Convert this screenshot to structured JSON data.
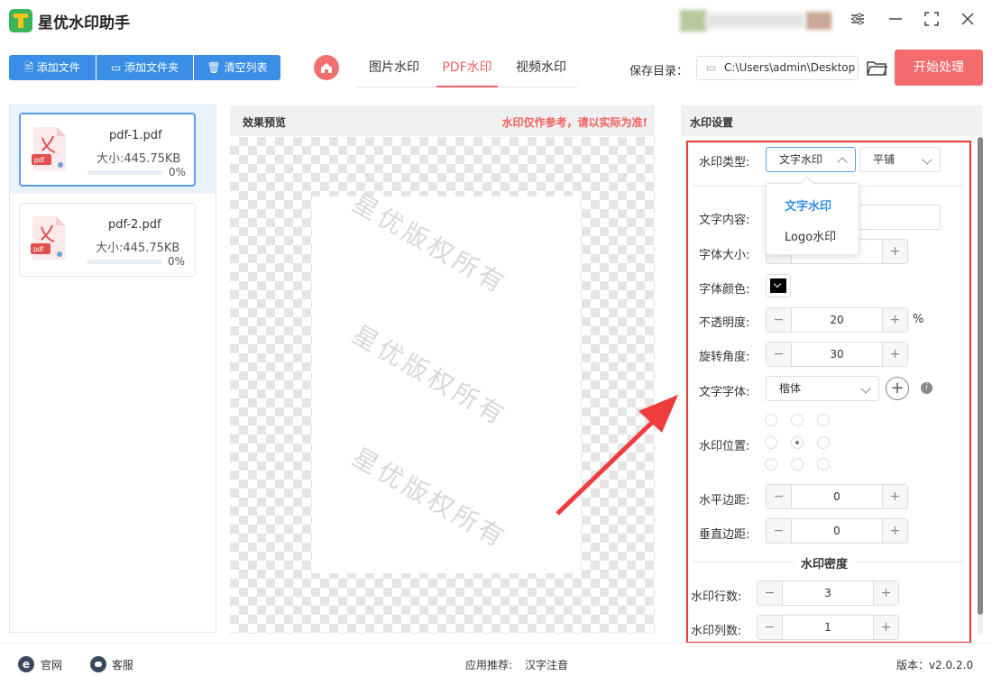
{
  "app": {
    "title": "星优水印助手"
  },
  "window_controls": [
    "settings-sliders",
    "minimize",
    "maximize",
    "close"
  ],
  "toolbar": {
    "add_file": "添加文件",
    "add_folder": "添加文件夹",
    "clear_list": "清空列表",
    "tabs": [
      "图片水印",
      "PDF水印",
      "视频水印"
    ],
    "active_tab": "PDF水印",
    "save_label": "保存目录：",
    "save_path": "C:\\Users\\admin\\Desktop",
    "start": "开始处理",
    "accent": "#3a8ee6",
    "start_color": "#f56c6c"
  },
  "files": [
    {
      "name": "pdf-1.pdf",
      "size": "大小:445.75KB",
      "progress": "0%",
      "progress_value": 0
    },
    {
      "name": "pdf-2.pdf",
      "size": "大小:445.75KB",
      "progress": "0%",
      "progress_value": 0
    }
  ],
  "preview": {
    "title": "效果预览",
    "notice": "水印仅作参考，请以实际为准!",
    "watermark_text": "星优版权所有"
  },
  "settings": {
    "title": "水印设置",
    "type_label": "水印类型:",
    "type_value": "文字水印",
    "layout_value": "平铺",
    "dropdown_options": [
      "文字水印",
      "Logo水印"
    ],
    "text_content_label": "文字内容:",
    "font_size_label": "字体大小:",
    "font_color_label": "字体颜色:",
    "opacity_label": "不透明度:",
    "opacity_value": "20",
    "opacity_unit": "%",
    "rotation_label": "旋转角度:",
    "rotation_value": "30",
    "font_label": "文字字体:",
    "font_value": "楷体",
    "position_label": "水印位置:",
    "h_margin_label": "水平边距:",
    "h_margin_value": "0",
    "v_margin_label": "垂直边距:",
    "v_margin_value": "0",
    "density_title": "水印密度",
    "rows_label": "水印行数:",
    "rows_value": "3",
    "cols_label": "水印列数:",
    "cols_value": "1",
    "minus": "−",
    "plus": "+"
  },
  "footer": {
    "website": "官网",
    "support": "客服",
    "recommend_label": "应用推荐:",
    "recommend_app": "汉字注音",
    "version": "版本：v2.0.2.0"
  }
}
